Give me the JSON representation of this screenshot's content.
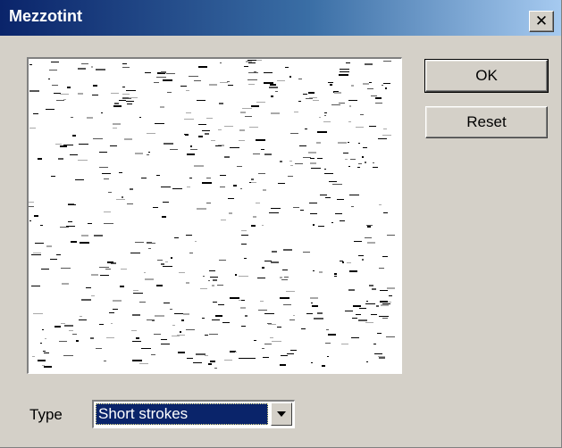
{
  "window": {
    "title": "Mezzotint",
    "close_glyph": "✕"
  },
  "preview": {
    "description_icon": "mezzotint-preview",
    "pattern": "short-strokes"
  },
  "buttons": {
    "ok_label": "OK",
    "reset_label": "Reset"
  },
  "type": {
    "label": "Type",
    "selected": "Short strokes"
  },
  "colors": {
    "titlebar_start": "#0a246a",
    "titlebar_end": "#a6caf0",
    "selection": "#0a246a",
    "face": "#d4d0c8"
  }
}
